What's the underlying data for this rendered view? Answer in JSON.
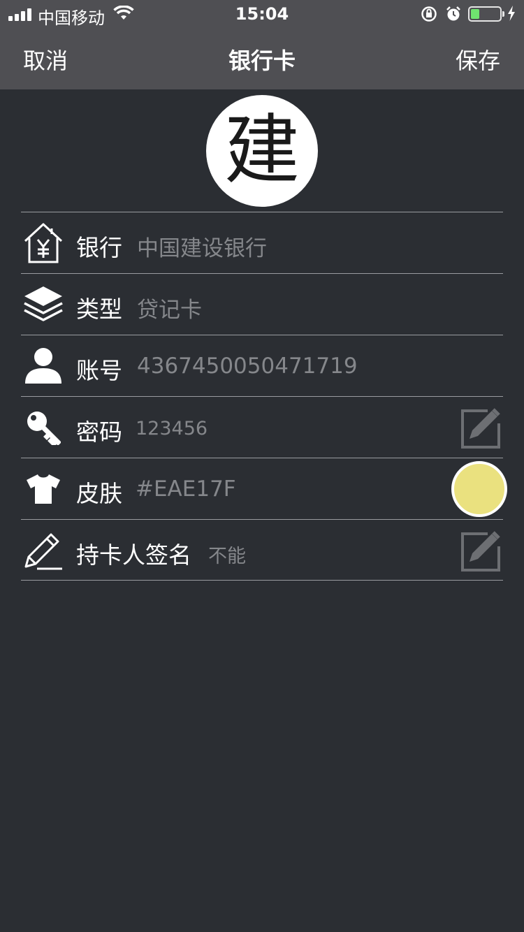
{
  "status_bar": {
    "carrier": "中国移动",
    "time": "15:04"
  },
  "nav": {
    "cancel_label": "取消",
    "title": "银行卡",
    "save_label": "保存"
  },
  "logo": {
    "glyph": "建"
  },
  "rows": [
    {
      "label": "银行",
      "value": "中国建设银行",
      "icon": "bank-icon"
    },
    {
      "label": "类型",
      "value": "贷记卡",
      "icon": "layers-icon"
    },
    {
      "label": "账号",
      "value": "4367450050471719",
      "icon": "user-icon"
    },
    {
      "label": "密码",
      "value": "123456",
      "icon": "key-icon"
    },
    {
      "label": "皮肤",
      "value": "#EAE17F",
      "icon": "tshirt-icon"
    },
    {
      "label": "持卡人签名",
      "value": "不能",
      "icon": "pencil-icon"
    }
  ],
  "colors": {
    "skin": "#EAE17F",
    "background": "#2b2e33",
    "header": "#4f4f53"
  }
}
